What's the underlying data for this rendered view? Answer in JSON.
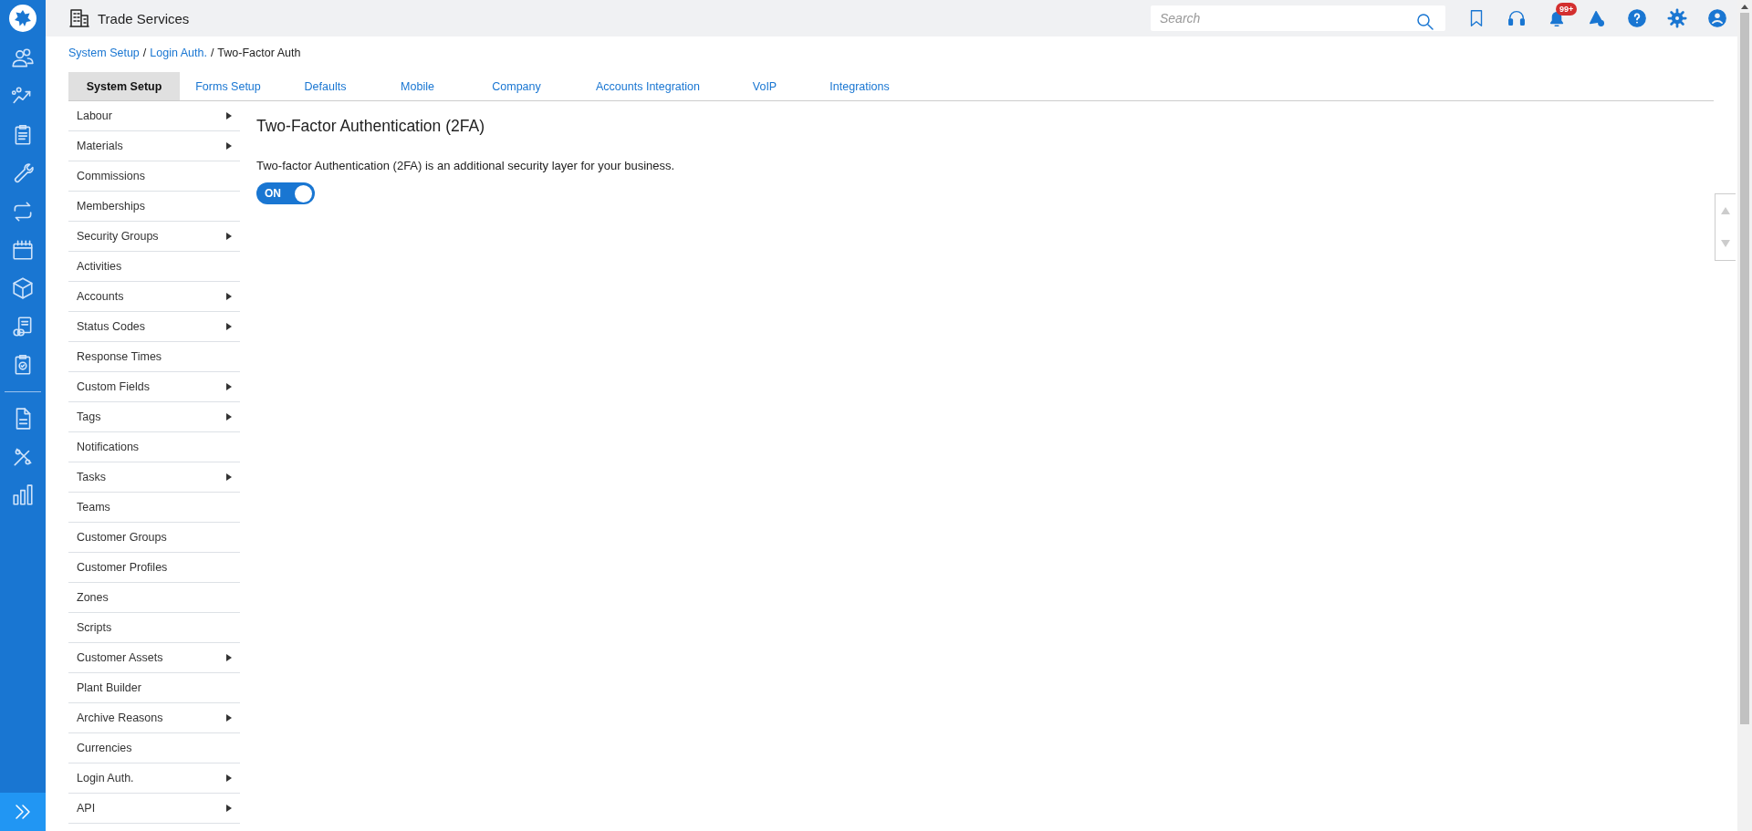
{
  "header": {
    "title": "Trade Services",
    "search": {
      "placeholder": "Search"
    },
    "notification_badge": "99+"
  },
  "breadcrumb": [
    {
      "label": "System Setup",
      "link": true
    },
    {
      "label": "Login Auth.",
      "link": true,
      "separator": "/"
    },
    {
      "label": "Two-Factor Auth",
      "link": false,
      "separator": "/"
    }
  ],
  "tabs": [
    {
      "label": "System Setup",
      "selected": true
    },
    {
      "label": "Forms Setup",
      "selected": false
    },
    {
      "label": "Defaults",
      "selected": false
    },
    {
      "label": "Mobile",
      "selected": false
    },
    {
      "label": "Company",
      "selected": false
    },
    {
      "label": "Accounts Integration",
      "selected": false
    },
    {
      "label": "VoIP",
      "selected": false
    },
    {
      "label": "Integrations",
      "selected": false
    }
  ],
  "menu": [
    {
      "label": "Labour",
      "submenu": true
    },
    {
      "label": "Materials",
      "submenu": true
    },
    {
      "label": "Commissions",
      "submenu": false
    },
    {
      "label": "Memberships",
      "submenu": false
    },
    {
      "label": "Security Groups",
      "submenu": true
    },
    {
      "label": "Activities",
      "submenu": false
    },
    {
      "label": "Accounts",
      "submenu": true
    },
    {
      "label": "Status Codes",
      "submenu": true
    },
    {
      "label": "Response Times",
      "submenu": false
    },
    {
      "label": "Custom Fields",
      "submenu": true
    },
    {
      "label": "Tags",
      "submenu": true
    },
    {
      "label": "Notifications",
      "submenu": false
    },
    {
      "label": "Tasks",
      "submenu": true
    },
    {
      "label": "Teams",
      "submenu": false
    },
    {
      "label": "Customer Groups",
      "submenu": false
    },
    {
      "label": "Customer Profiles",
      "submenu": false
    },
    {
      "label": "Zones",
      "submenu": false
    },
    {
      "label": "Scripts",
      "submenu": false
    },
    {
      "label": "Customer Assets",
      "submenu": true
    },
    {
      "label": "Plant Builder",
      "submenu": false
    },
    {
      "label": "Archive Reasons",
      "submenu": true
    },
    {
      "label": "Currencies",
      "submenu": false
    },
    {
      "label": "Login Auth.",
      "submenu": true
    },
    {
      "label": "API",
      "submenu": true
    }
  ],
  "content": {
    "title": "Two-Factor Authentication (2FA)",
    "description": "Two-factor Authentication (2FA) is an additional security layer for your business.",
    "toggle": {
      "label": "ON",
      "on": true
    }
  }
}
